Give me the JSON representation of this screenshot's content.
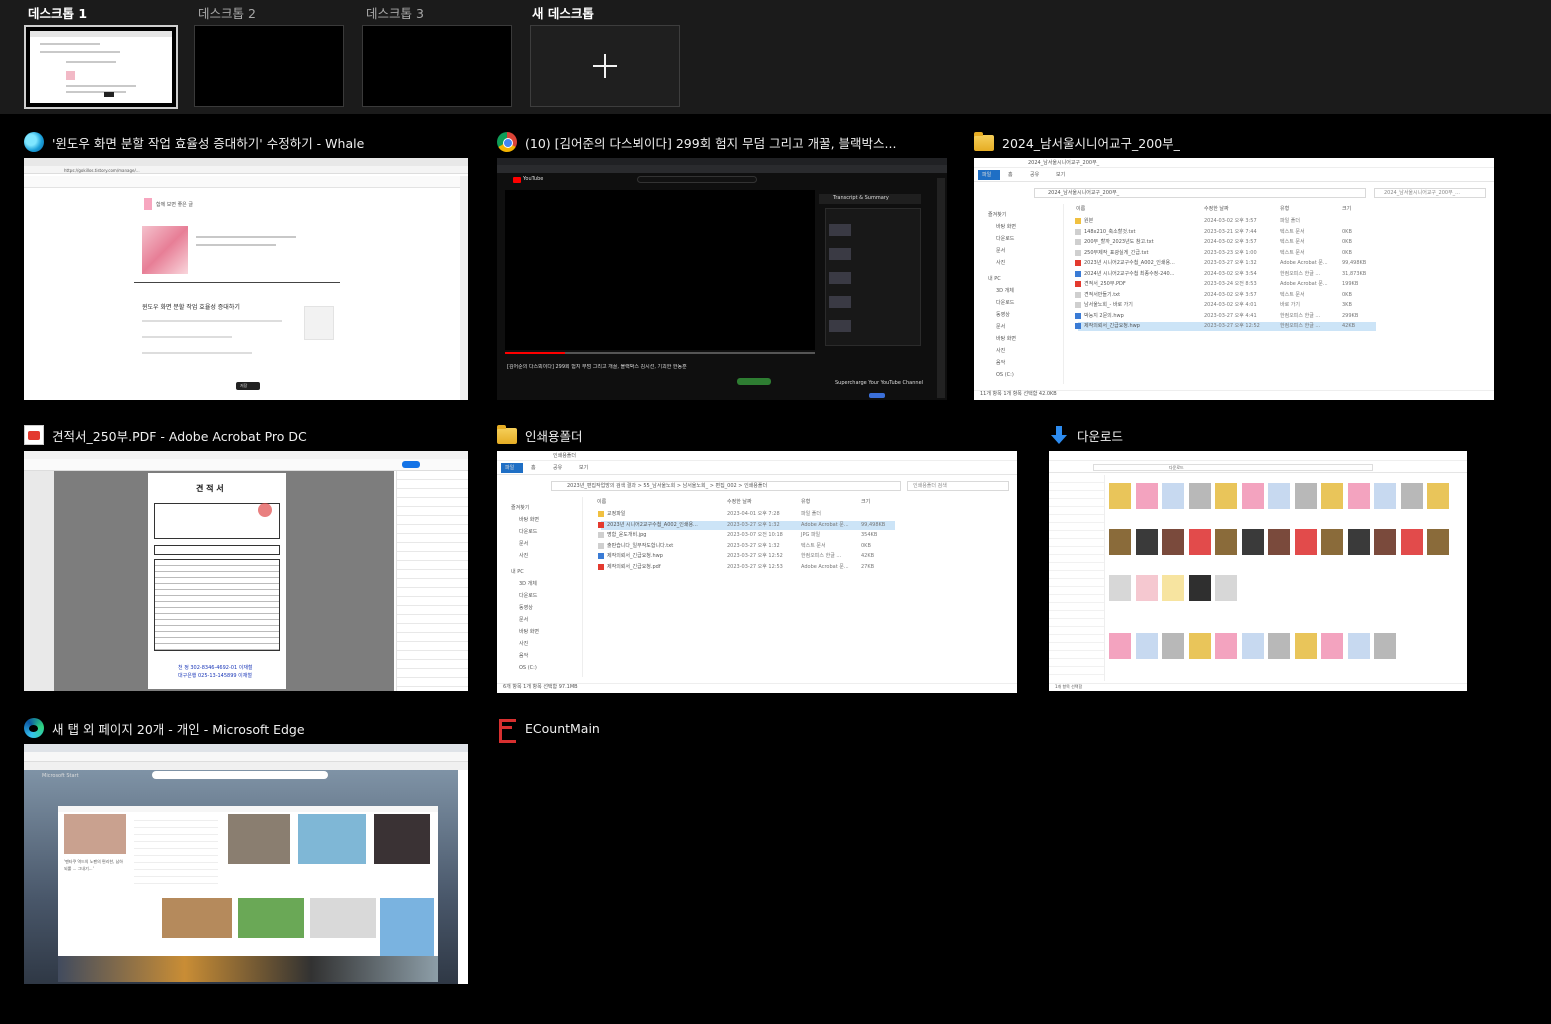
{
  "desktops": [
    {
      "label": "데스크톱 1",
      "active": true
    },
    {
      "label": "데스크톱 2",
      "active": false
    },
    {
      "label": "데스크톱 3",
      "active": false
    }
  ],
  "new_desktop_label": "새 데스크톱",
  "windows": {
    "whale": {
      "title": "'윈도우 화면 분할 작업 효율성 증대하기' 수정하기 - Whale",
      "icon": "whale-browser-icon",
      "content": {
        "post_title": "윈도우 화면 분할 작업 효율성 증대하기",
        "section": "함께 보면 좋은 글",
        "save_button": "저장",
        "url": "https://gokillos.tistory.com/manage/..."
      }
    },
    "chrome": {
      "title": "(10) [김어준의 다스뵈이다] 299회 험지 무덤 그리고 개꿀, 블랙박스...",
      "icon": "chrome-icon",
      "content": {
        "site": "YouTube",
        "video_title": "[김어준의 다스뵈이다] 299회 험지 무덤 그리고 개꿀, 블랙박스 김시선, 기괴한 한동훈",
        "panel_title": "Transcript & Summary",
        "promo": "Supercharge Your YouTube Channel"
      }
    },
    "explorer_senior": {
      "title": "2024_남서울시니어교구_200부_",
      "icon": "folder-icon",
      "content": {
        "tabs": [
          "파일",
          "홈",
          "공유",
          "보기"
        ],
        "path": "2024_남서울시니어교구_200부_",
        "search": "2024_남서울시니어교구_200부_...",
        "columns": [
          "이름",
          "수정한 날짜",
          "유형",
          "크기"
        ],
        "sidebar": [
          "즐겨찾기",
          "바탕 화면",
          "다운로드",
          "문서",
          "사진",
          "내 PC",
          "3D 개체",
          "다운로드",
          "동영상",
          "문서",
          "바탕 화면",
          "사진",
          "음악",
          "OS (C:)"
        ],
        "files": [
          {
            "name": "원본",
            "date": "2024-03-02 오후 3:57",
            "type": "파일 폴더",
            "size": ""
          },
          {
            "name": "148x210_축소할것.txt",
            "date": "2023-03-21 오후 7:44",
            "type": "텍스트 문서",
            "size": "0KB"
          },
          {
            "name": "200부_할까_2023년도 참고.txt",
            "date": "2024-03-02 오후 3:57",
            "type": "텍스트 문서",
            "size": "0KB"
          },
          {
            "name": "250부제작_표광실게_긴급.txt",
            "date": "2023-03-23 오후 1:00",
            "type": "텍스트 문서",
            "size": "0KB"
          },
          {
            "name": "2023년 시니어2교구수첩_A002_인쇄용...",
            "date": "2023-03-27 오후 1:32",
            "type": "Adobe Acrobat 문...",
            "size": "99,498KB"
          },
          {
            "name": "2024년 시니어2교구수첩 최종수정-240...",
            "date": "2024-03-02 오후 3:54",
            "type": "한컴오피스 한글 ...",
            "size": "31,873KB"
          },
          {
            "name": "견적서_250부.PDF",
            "date": "2023-03-24 오전 8:53",
            "type": "Adobe Acrobat 문...",
            "size": "199KB"
          },
          {
            "name": "견적서만들기.txt",
            "date": "2024-03-02 오후 3:57",
            "type": "텍스트 문서",
            "size": "0KB"
          },
          {
            "name": "남서울노회_- 바로 가기",
            "date": "2024-03-02 오후 4:01",
            "type": "바로 가기",
            "size": "3KB"
          },
          {
            "name": "박능지 2문의.hwp",
            "date": "2023-03-27 오후 4:41",
            "type": "한컴오피스 한글 ...",
            "size": "299KB"
          },
          {
            "name": "제작의뢰서_긴급요청.hwp",
            "date": "2023-03-27 오후 12:52",
            "type": "한컴오피스 한글 ...",
            "size": "42KB"
          }
        ],
        "status": "11개 항목   1개 항목 선택함 42.0KB"
      }
    },
    "acrobat": {
      "title": "견적서_250부.PDF - Adobe Acrobat Pro DC",
      "icon": "acrobat-pdf-icon",
      "content": {
        "doc_heading": "견 적 서",
        "footer_line1": "천 정 302-8346-4692-01 이재철",
        "footer_line2": "대구은행 025-13-145899 이재철"
      }
    },
    "explorer_print": {
      "title": "인쇄용폴더",
      "icon": "folder-icon",
      "content": {
        "tabs": [
          "파일",
          "홈",
          "공유",
          "보기"
        ],
        "path": "2023년_편집작업방의 검색 결과 > 55_남서울노회 > 남서울노회_ > 편집_002 > 인쇄용폴더",
        "search": "인쇄용폴더 검색",
        "columns": [
          "이름",
          "수정한 날짜",
          "유형",
          "크기"
        ],
        "sidebar": [
          "즐겨찾기",
          "바탕 화면",
          "다운로드",
          "문서",
          "사진",
          "내 PC",
          "3D 개체",
          "다운로드",
          "동영상",
          "문서",
          "바탕 화면",
          "사진",
          "음악",
          "OS (C:)"
        ],
        "files": [
          {
            "name": "교정파일",
            "date": "2023-04-01 오후 7:28",
            "type": "파일 폴더",
            "size": ""
          },
          {
            "name": "2023년 시니어2교구수첩_A002_인쇄용...",
            "date": "2023-03-27 오후 1:32",
            "type": "Adobe Acrobat 문...",
            "size": "99,498KB"
          },
          {
            "name": "명함_윤도개비.jpg",
            "date": "2023-03-07 오전 10:18",
            "type": "JPG 파일",
            "size": "354KB"
          },
          {
            "name": "출판습니다_일부작도합니다.txt",
            "date": "2023-03-27 오후 1:32",
            "type": "텍스트 문서",
            "size": "0KB"
          },
          {
            "name": "제작의뢰서_긴급요청.hwp",
            "date": "2023-03-27 오후 12:52",
            "type": "한컴오피스 한글 ...",
            "size": "42KB"
          },
          {
            "name": "제작의뢰서_긴급요청.pdf",
            "date": "2023-03-27 오후 12:53",
            "type": "Adobe Acrobat 문...",
            "size": "27KB"
          }
        ],
        "status": "6개 항목   1개 항목 선택함 97.1MB"
      }
    },
    "downloads": {
      "title": "다운로드",
      "icon": "download-arrow-icon",
      "content": {
        "path": "다운로드",
        "status": "1개 항목 선택함"
      }
    },
    "edge": {
      "title": "새 탭 외 페이지 20개 - 개인 - Microsoft Edge",
      "icon": "edge-icon",
      "content": {
        "brand": "Microsoft Start",
        "headline": "'펜타쿠 역드의 노팬의 편리한, 남하 되롤 ... 그내기...'"
      }
    },
    "ecount": {
      "title": "ECountMain",
      "icon": "ecount-icon"
    }
  },
  "colors": {
    "background": "#000000",
    "strip": "#1b1b1b",
    "accent_blue": "#2d8cf0",
    "youtube_red": "#ff0000",
    "ecount_red": "#d83030"
  }
}
